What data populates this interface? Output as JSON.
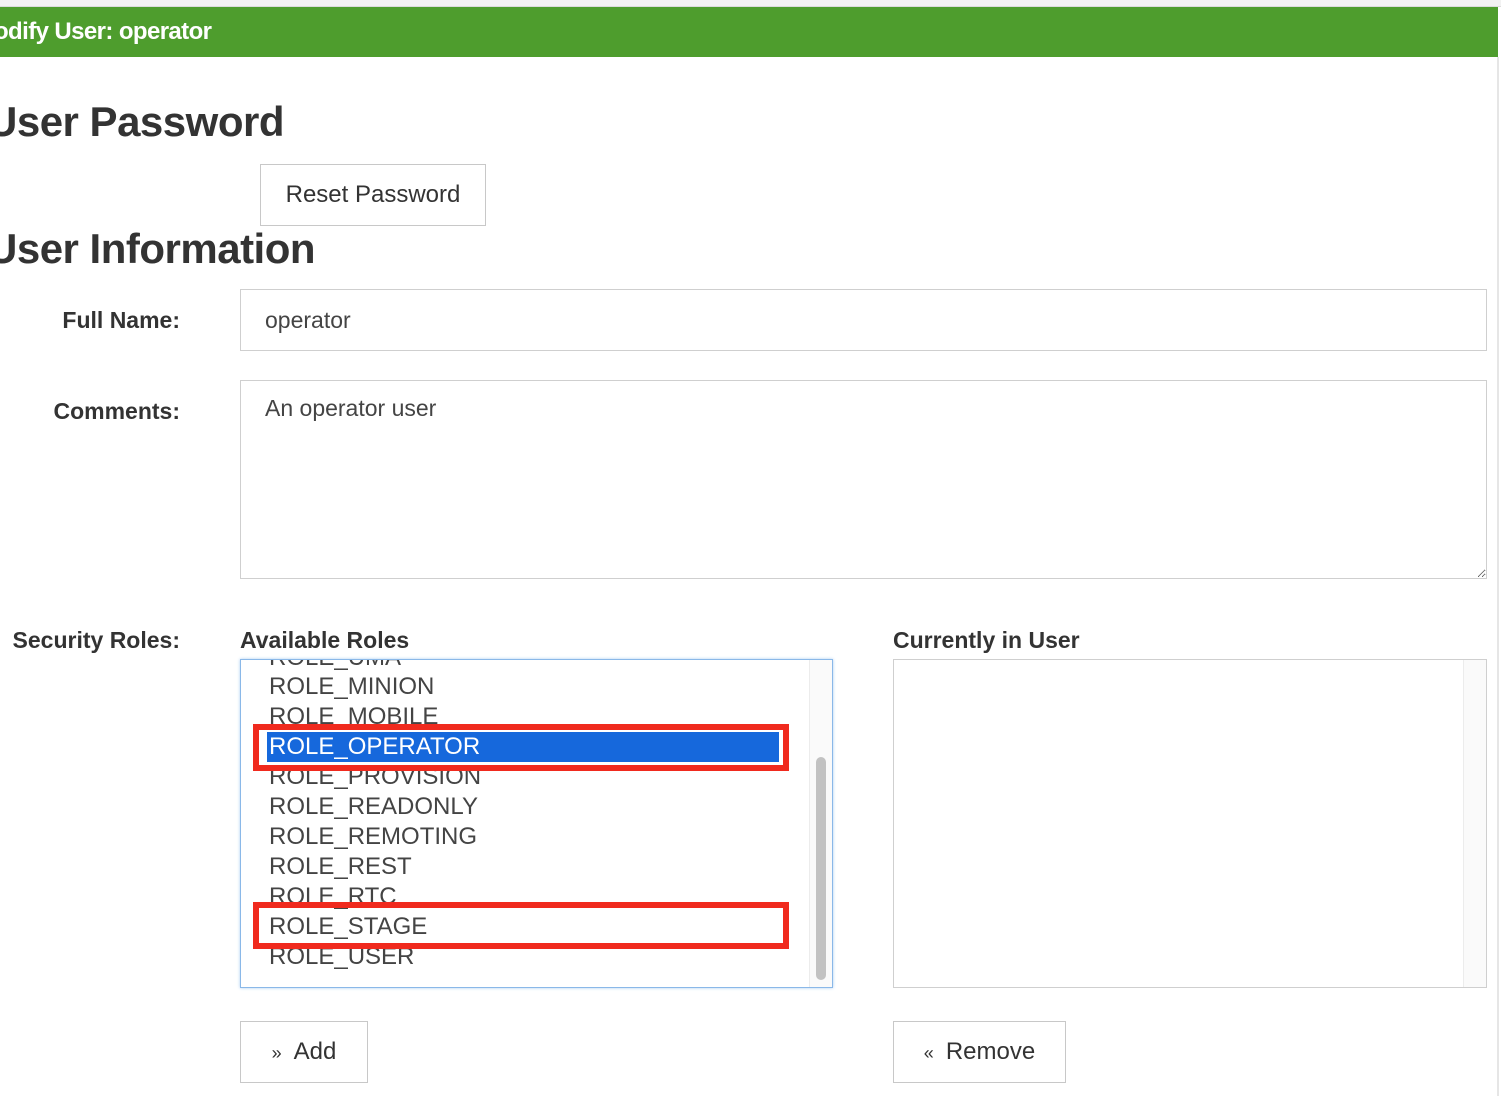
{
  "page": {
    "title": "odify User: operator"
  },
  "password_section": {
    "heading": "User Password",
    "reset_button_label": "Reset Password"
  },
  "info_section": {
    "heading": "User Information",
    "full_name_label": "Full Name:",
    "full_name_value": "operator",
    "comments_label": "Comments:",
    "comments_value": "An operator user"
  },
  "roles": {
    "label": "Security Roles:",
    "available_heading": "Available Roles",
    "current_heading": "Currently in User",
    "available_items": [
      "ROLE_UMA",
      "ROLE_MINION",
      "ROLE_MOBILE",
      "ROLE_OPERATOR",
      "ROLE_PROVISION",
      "ROLE_READONLY",
      "ROLE_REMOTING",
      "ROLE_REST",
      "ROLE_RTC",
      "ROLE_STAGE",
      "ROLE_USER"
    ],
    "selected_item": "ROLE_OPERATOR",
    "current_items": [],
    "add_button_glyph": "»",
    "add_button_label": "Add",
    "remove_button_glyph": "«",
    "remove_button_label": "Remove"
  },
  "colors": {
    "titlebar": "#4e9d2d",
    "selection": "#1668dc",
    "highlight_box": "#f02a1e"
  }
}
